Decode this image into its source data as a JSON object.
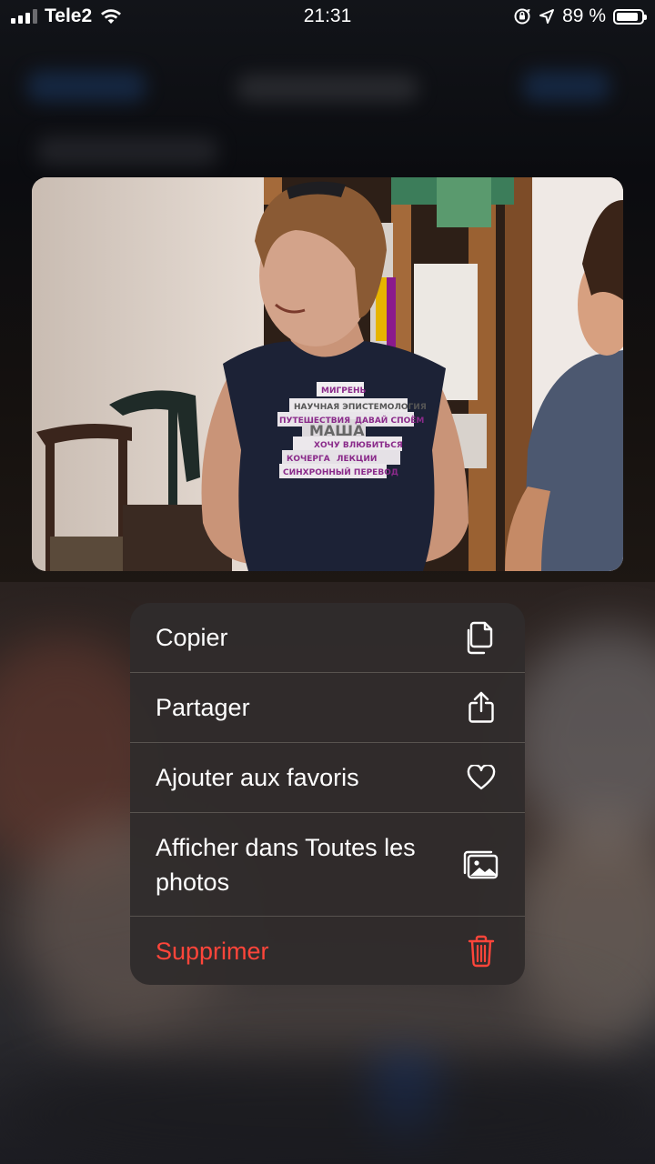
{
  "status_bar": {
    "carrier": "Tele2",
    "time": "21:31",
    "battery_percent": "89 %",
    "battery_level": 0.89
  },
  "photo": {
    "description_icon": "photo-preview",
    "shirt_words": [
      "МИГРЕНЬ",
      "НАУЧНАЯ ЭПИСТЕМОЛОГИЯ",
      "ПУТЕШЕСТВИЯ",
      "ДАВАЙ СПОЁМ",
      "МАША",
      "ХОЧУ ВЛЮБИТЬСЯ",
      "КОЧЕРГА",
      "ЛЕКЦИИ",
      "СИНХРОННЫЙ ПЕРЕВОД"
    ]
  },
  "menu": {
    "items": [
      {
        "label": "Copier",
        "icon": "copy-icon",
        "destructive": false
      },
      {
        "label": "Partager",
        "icon": "share-icon",
        "destructive": false
      },
      {
        "label": "Ajouter aux favoris",
        "icon": "heart-icon",
        "destructive": false
      },
      {
        "label": "Afficher dans Toutes les photos",
        "icon": "photos-icon",
        "destructive": false
      },
      {
        "label": "Supprimer",
        "icon": "trash-icon",
        "destructive": true
      }
    ]
  },
  "colors": {
    "destructive": "#ff453a",
    "menu_bg": "#302c2c",
    "separator": "#58534f"
  }
}
